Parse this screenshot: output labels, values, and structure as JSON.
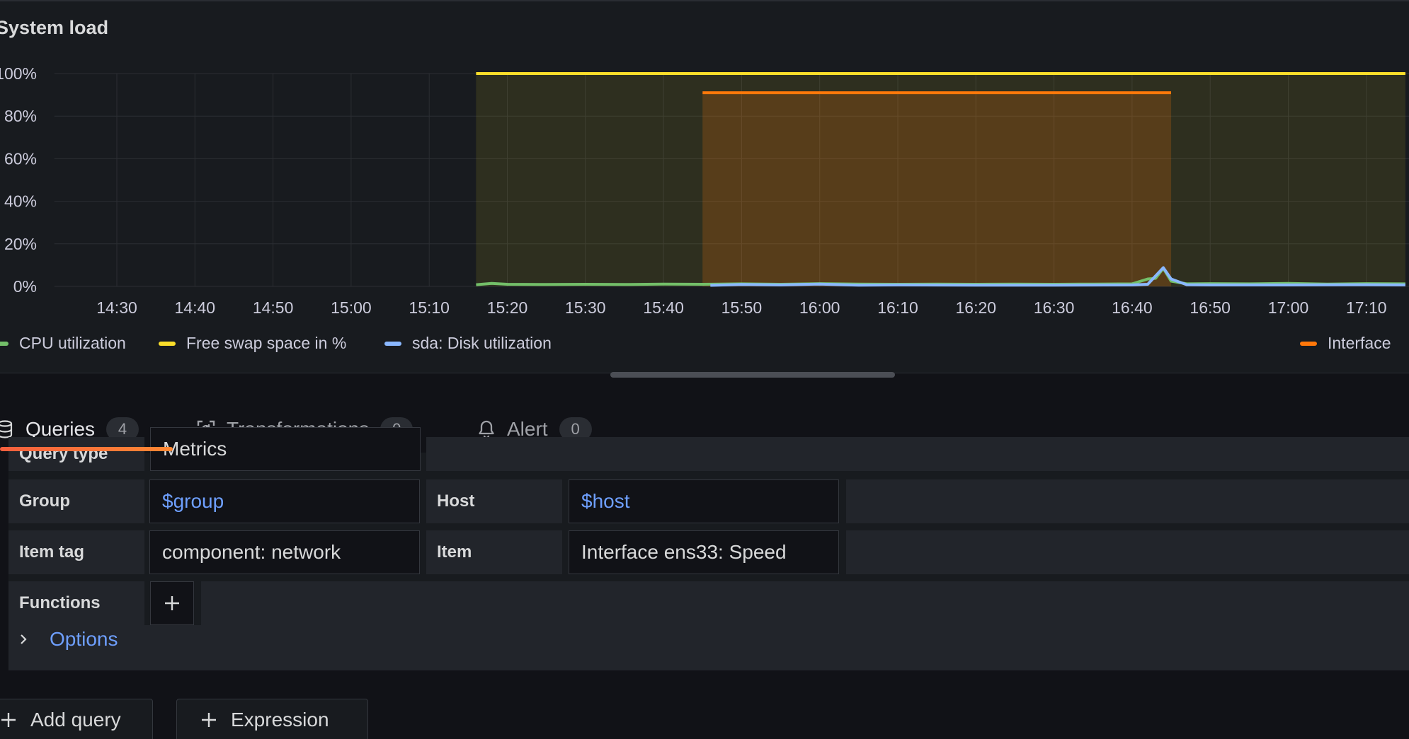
{
  "panel": {
    "title": "System load"
  },
  "chart_data": {
    "type": "line",
    "title": "System load",
    "x_ticks": [
      "14:30",
      "14:40",
      "14:50",
      "15:00",
      "15:10",
      "15:20",
      "15:30",
      "15:40",
      "15:50",
      "16:00",
      "16:10",
      "16:20",
      "16:30",
      "16:40",
      "16:50",
      "17:00",
      "17:10"
    ],
    "y_ticks": [
      "0%",
      "20%",
      "40%",
      "60%",
      "80%",
      "100%"
    ],
    "ylim": [
      0,
      100
    ],
    "xlim": [
      "14:22",
      "17:15"
    ],
    "grid": true,
    "legend_position": "bottom",
    "series": [
      {
        "name": "CPU utilization",
        "color": "#73bf69",
        "x": [
          "15:16",
          "15:18",
          "15:20",
          "15:25",
          "15:30",
          "15:35",
          "15:40",
          "15:45",
          "15:50",
          "15:55",
          "16:00",
          "16:05",
          "16:10",
          "16:15",
          "16:20",
          "16:25",
          "16:30",
          "16:35",
          "16:40",
          "16:42",
          "16:43",
          "16:44",
          "16:45",
          "16:47",
          "16:50",
          "16:55",
          "17:00",
          "17:05",
          "17:10",
          "17:15"
        ],
        "y": [
          0.8,
          1.4,
          1.0,
          0.9,
          1.0,
          0.9,
          1.1,
          1.0,
          1.2,
          1.0,
          1.3,
          1.1,
          1.0,
          1.1,
          1.0,
          1.1,
          1.0,
          1.1,
          1.2,
          3.5,
          3.8,
          8.5,
          2.5,
          1.2,
          1.3,
          1.2,
          1.4,
          1.1,
          1.3,
          1.2
        ]
      },
      {
        "name": "Free swap space in %",
        "color": "#fade2a",
        "x": [
          "15:16",
          "17:15"
        ],
        "y": [
          100,
          100
        ],
        "fill": true
      },
      {
        "name": "sda: Disk utilization",
        "color": "#8ab8ff",
        "x": [
          "15:46",
          "15:50",
          "15:55",
          "16:00",
          "16:05",
          "16:10",
          "16:20",
          "16:30",
          "16:40",
          "16:42",
          "16:44",
          "16:45",
          "16:47",
          "16:50",
          "17:00",
          "17:10",
          "17:15"
        ],
        "y": [
          0.5,
          0.9,
          0.7,
          1.1,
          0.6,
          0.7,
          0.6,
          0.6,
          0.7,
          1.0,
          8.8,
          3.5,
          0.8,
          0.7,
          0.7,
          0.8,
          0.7
        ]
      },
      {
        "name": "Interface ens33: Speed",
        "color": "#ff780a",
        "x": [
          "15:45",
          "16:45"
        ],
        "y": [
          91,
          91
        ],
        "fill": true
      }
    ]
  },
  "legend": {
    "items": [
      {
        "label": "CPU utilization",
        "color": "#73bf69"
      },
      {
        "label": "Free swap space in %",
        "color": "#fade2a"
      },
      {
        "label": "sda: Disk utilization",
        "color": "#8ab8ff"
      },
      {
        "label": "Interface",
        "color": "#ff780a"
      }
    ]
  },
  "tabs": [
    {
      "label": "Queries",
      "count": "4",
      "icon": "database-icon"
    },
    {
      "label": "Transformations",
      "count": "0",
      "icon": "transform-icon"
    },
    {
      "label": "Alert",
      "count": "0",
      "icon": "bell-icon"
    }
  ],
  "editor": {
    "query_type_label": "Query type",
    "query_type_value": "Metrics",
    "group_label": "Group",
    "group_value": "$group",
    "host_label": "Host",
    "host_value": "$host",
    "item_tag_label": "Item tag",
    "item_tag_value": "component: network",
    "item_label": "Item",
    "item_value": "Interface ens33: Speed",
    "functions_label": "Functions",
    "options_label": "Options"
  },
  "actions": {
    "add_query": "Add query",
    "expression": "Expression"
  }
}
